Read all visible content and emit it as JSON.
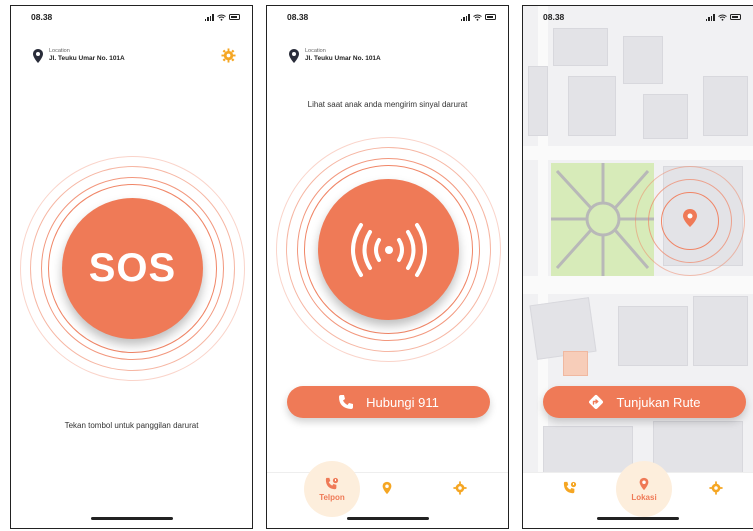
{
  "screens": [
    {
      "status_time": "08.38",
      "location_label": "Location",
      "location_address": "Jl. Teuku Umar No. 101A",
      "sos_label": "SOS",
      "hint": "Tekan tombol untuk panggilan darurat"
    },
    {
      "status_time": "08.38",
      "location_label": "Location",
      "location_address": "Jl. Teuku Umar No. 101A",
      "subtitle": "Lihat saat anak anda mengirim sinyal darurat",
      "call_button": "Hubungi 911",
      "tabs": {
        "active_label": "Telpon"
      }
    },
    {
      "status_time": "08.38",
      "route_button": "Tunjukan Rute",
      "tabs": {
        "active_label": "Lokasi"
      }
    }
  ],
  "colors": {
    "accent": "#ef7a57",
    "gear": "#f5a623",
    "map_pin": "#ef7a57",
    "park": "#d7ebb9"
  },
  "icons": [
    "location-pin-icon",
    "gear-icon",
    "signal-icon",
    "wifi-icon",
    "battery-icon",
    "broadcast-icon",
    "phone-icon",
    "route-icon"
  ]
}
